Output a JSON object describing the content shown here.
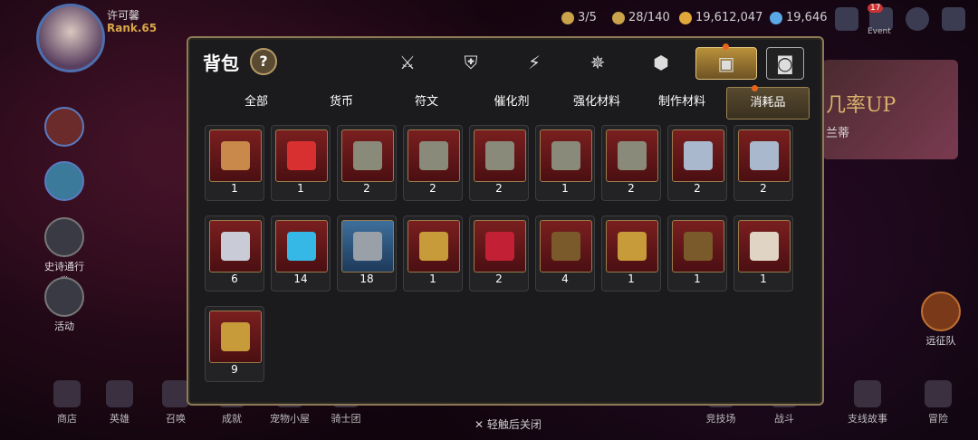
{
  "player": {
    "name": "许可馨",
    "rank": "Rank.65"
  },
  "resources": [
    {
      "id": "ticket",
      "value": "3/5",
      "color": "#c9a24a"
    },
    {
      "id": "stamina",
      "value": "28/140",
      "color": "#c9a24a"
    },
    {
      "id": "gold",
      "value": "19,612,047",
      "color": "#e0a83a"
    },
    {
      "id": "gem",
      "value": "19,646",
      "color": "#5aa8e6"
    }
  ],
  "event": {
    "badge": "17",
    "label": "Event"
  },
  "side_left": [
    {
      "label": "史诗通行劵"
    },
    {
      "label": "活动"
    }
  ],
  "side_right": [
    {
      "label": "远征队"
    }
  ],
  "banner": {
    "title": "几率UP",
    "subtitle": "兰蒂"
  },
  "bottom_nav": [
    "商店",
    "英雄",
    "召唤",
    "成就",
    "宠物小屋",
    "骑士团",
    "竞技场",
    "战斗",
    "支线故事",
    "冒险"
  ],
  "dialog": {
    "title": "背包",
    "help": "?",
    "categories": [
      {
        "icon": "sword-shield-icon",
        "glyph": "⚔"
      },
      {
        "icon": "broken-shield-icon",
        "glyph": "⛨"
      },
      {
        "icon": "lightning-icon",
        "glyph": "⚡"
      },
      {
        "icon": "crystal-icon",
        "glyph": "✵"
      },
      {
        "icon": "cube-icon",
        "glyph": "⬢"
      },
      {
        "icon": "backpack-icon",
        "glyph": "▣"
      },
      {
        "icon": "chest-icon",
        "glyph": "◙"
      }
    ],
    "selected_category": 5,
    "tabs": [
      "全部",
      "货币",
      "符文",
      "催化剂",
      "强化材料",
      "制作材料",
      "消耗品"
    ],
    "selected_tab": 6,
    "items": [
      {
        "qty": "1",
        "kind": "scroll"
      },
      {
        "qty": "1",
        "kind": "potion"
      },
      {
        "qty": "2",
        "kind": "equip-box"
      },
      {
        "qty": "2",
        "kind": "equip-box"
      },
      {
        "qty": "2",
        "kind": "equip-box"
      },
      {
        "qty": "1",
        "kind": "equip-box"
      },
      {
        "qty": "2",
        "kind": "equip-box"
      },
      {
        "qty": "2",
        "kind": "silver-box"
      },
      {
        "qty": "2",
        "kind": "silver-box"
      },
      {
        "qty": "6",
        "kind": "silver-chest"
      },
      {
        "qty": "14",
        "kind": "blue-chest"
      },
      {
        "qty": "18",
        "kind": "dark-chest"
      },
      {
        "qty": "1",
        "kind": "gift-chest"
      },
      {
        "qty": "2",
        "kind": "red-box"
      },
      {
        "qty": "4",
        "kind": "gold-chest"
      },
      {
        "qty": "1",
        "kind": "gift-chest"
      },
      {
        "qty": "1",
        "kind": "gold-chest"
      },
      {
        "qty": "1",
        "kind": "white-chest"
      },
      {
        "qty": "9",
        "kind": "gift-chest"
      }
    ],
    "close_hint": "✕ 轻触后关闭"
  }
}
